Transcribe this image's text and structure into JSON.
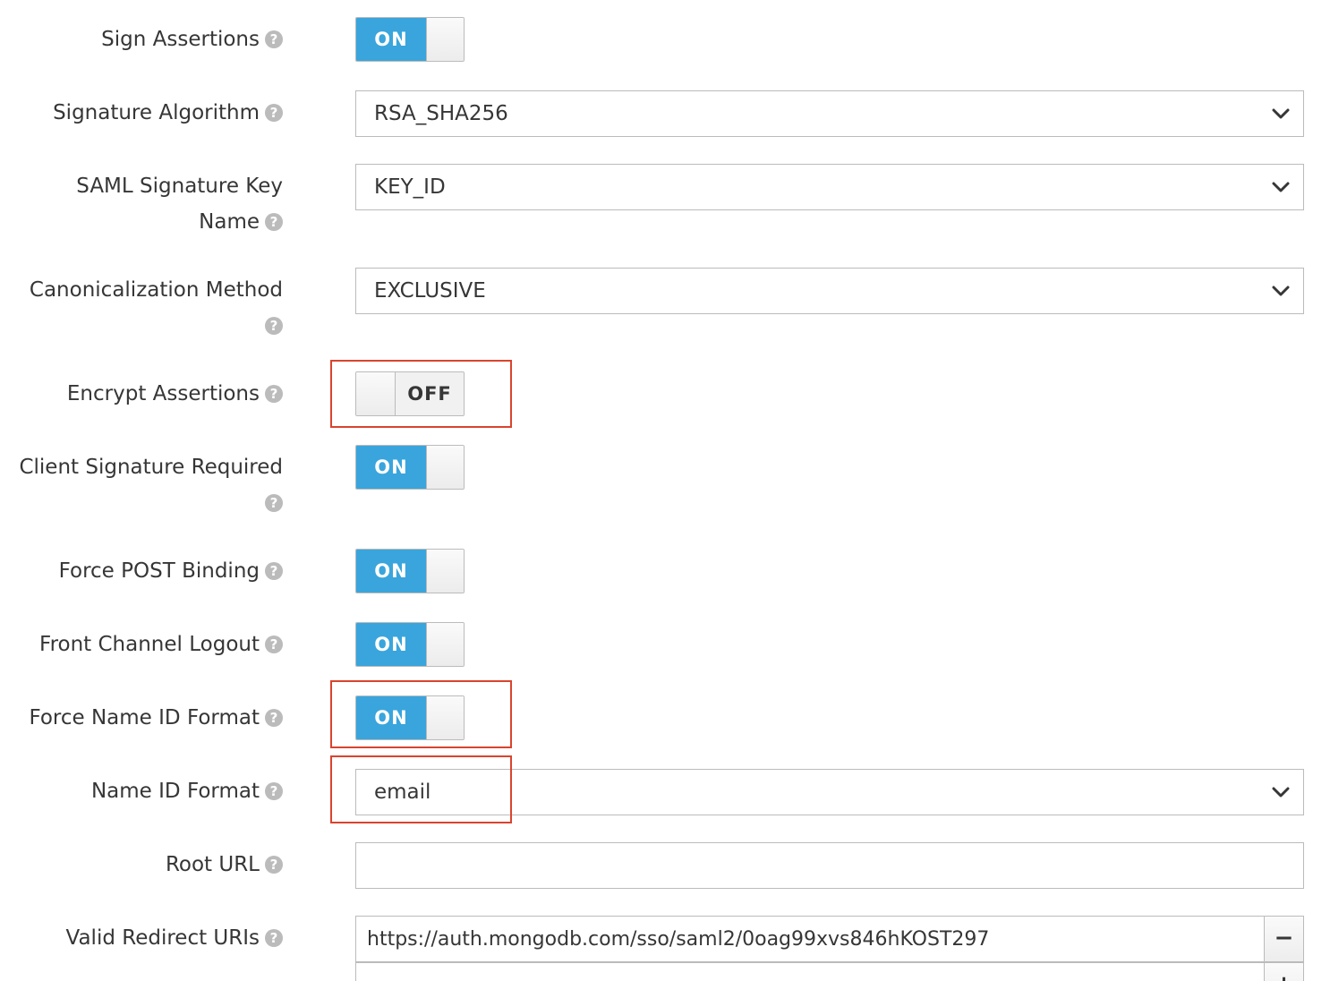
{
  "help_icon_glyph": "?",
  "fields": {
    "sign_assertions": {
      "label": "Sign Assertions",
      "state": "ON"
    },
    "signature_algorithm": {
      "label": "Signature Algorithm",
      "value": "RSA_SHA256"
    },
    "saml_signature_key_name": {
      "label_line1": "SAML Signature Key",
      "label_line2": "Name",
      "value": "KEY_ID"
    },
    "canonicalization_method": {
      "label": "Canonicalization Method",
      "value": "EXCLUSIVE"
    },
    "encrypt_assertions": {
      "label": "Encrypt Assertions",
      "state": "OFF"
    },
    "client_signature_required": {
      "label": "Client Signature Required",
      "state": "ON"
    },
    "force_post_binding": {
      "label": "Force POST Binding",
      "state": "ON"
    },
    "front_channel_logout": {
      "label": "Front Channel Logout",
      "state": "ON"
    },
    "force_name_id_format": {
      "label": "Force Name ID Format",
      "state": "ON"
    },
    "name_id_format": {
      "label": "Name ID Format",
      "value": "email"
    },
    "root_url": {
      "label": "Root URL",
      "value": ""
    },
    "valid_redirect_uris": {
      "label": "Valid Redirect URIs",
      "uris": [
        "https://auth.mongodb.com/sso/saml2/0oag99xvs846hKOST297",
        ""
      ],
      "remove_label": "−",
      "add_label": "+"
    }
  },
  "colors": {
    "toggle_on": "#39a5dc",
    "highlight": "#d9442f",
    "help_icon": "#bbbbbb"
  },
  "icons": {
    "help": "question-circle-icon",
    "select_arrow": "chevron-down-icon"
  }
}
